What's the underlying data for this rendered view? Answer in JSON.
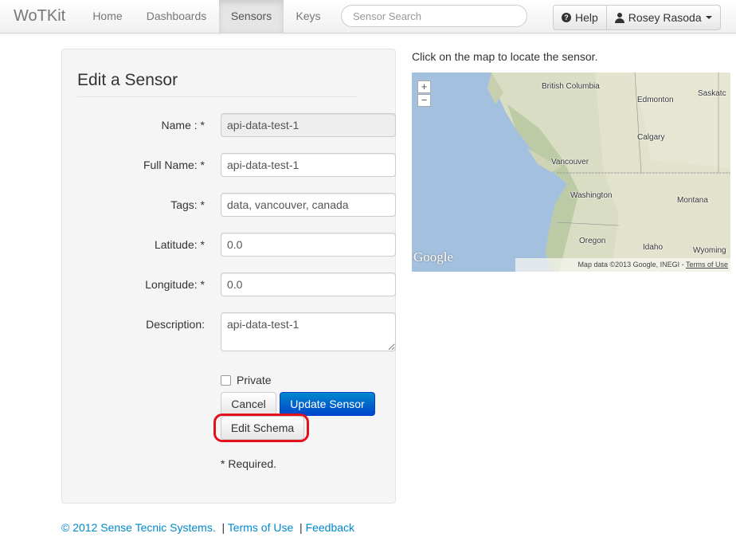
{
  "navbar": {
    "brand": "WoTKit",
    "items": [
      {
        "label": "Home",
        "active": false
      },
      {
        "label": "Dashboards",
        "active": false
      },
      {
        "label": "Sensors",
        "active": true
      },
      {
        "label": "Keys",
        "active": false
      }
    ],
    "search_placeholder": "Sensor Search",
    "help_label": "Help",
    "user_label": "Rosey Rasoda"
  },
  "form": {
    "title": "Edit a Sensor",
    "fields": [
      {
        "label": "Name : *",
        "value": "api-data-test-1",
        "readonly": true
      },
      {
        "label": "Full Name: *",
        "value": "api-data-test-1"
      },
      {
        "label": "Tags: *",
        "value": "data, vancouver, canada"
      },
      {
        "label": "Latitude: *",
        "value": "0.0"
      },
      {
        "label": "Longitude: *",
        "value": "0.0"
      },
      {
        "label": "Description:",
        "value": "api-data-test-1"
      }
    ],
    "private_label": "Private",
    "private_checked": false,
    "cancel_label": "Cancel",
    "update_label": "Update Sensor",
    "edit_schema_label": "Edit Schema",
    "required_note": "* Required."
  },
  "map": {
    "caption": "Click on the map to locate the sensor.",
    "zoom_in": "+",
    "zoom_out": "−",
    "labels": [
      "British Columbia",
      "Edmonton",
      "Saskatc",
      "Calgary",
      "Vancouver",
      "Washington",
      "Montana",
      "Oregon",
      "Idaho",
      "Wyoming"
    ],
    "logo": "Google",
    "attribution": "Map data ©2013 Google, INEGI - ",
    "terms_link": "Terms of Use"
  },
  "footer": {
    "copyright": "© 2012 Sense Tecnic Systems.",
    "separator": "|",
    "terms": "Terms of Use",
    "feedback": "Feedback"
  },
  "colors": {
    "primary": "#0088cc",
    "highlight": "#e3131b",
    "water": "#a3c0df"
  }
}
